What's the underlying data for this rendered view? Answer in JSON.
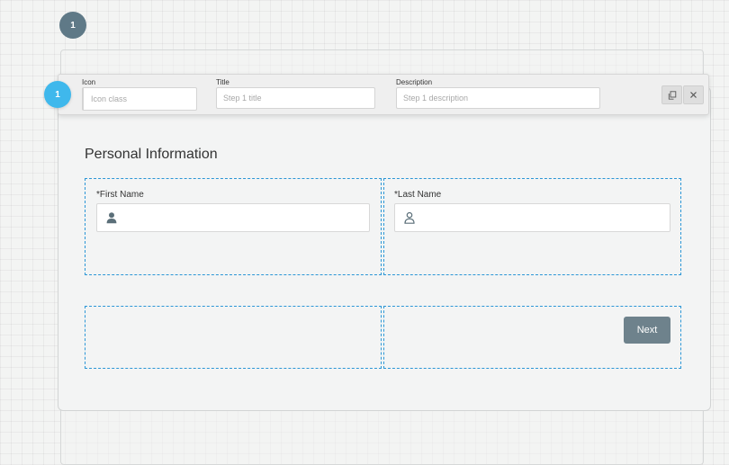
{
  "steps": [
    {
      "number": "1"
    }
  ],
  "toolbar": {
    "icon_label": "Icon",
    "icon_placeholder": "Icon class",
    "title_label": "Title",
    "title_placeholder": "Step 1 title",
    "description_label": "Description",
    "description_placeholder": "Step 1 description",
    "active_step": "1",
    "duplicate_icon": "copy-icon",
    "delete_icon": "close-icon"
  },
  "form": {
    "section_title": "Personal Information",
    "first_name_label": "*First Name",
    "last_name_label": "*Last Name",
    "first_name_icon": "user-solid-icon",
    "last_name_icon": "user-outline-icon",
    "next_label": "Next"
  },
  "colors": {
    "step_badge": "#5f7987",
    "active_step_badge": "#3fb8ec",
    "cell_border": "#2b96d6",
    "next_button": "#6e828c"
  }
}
